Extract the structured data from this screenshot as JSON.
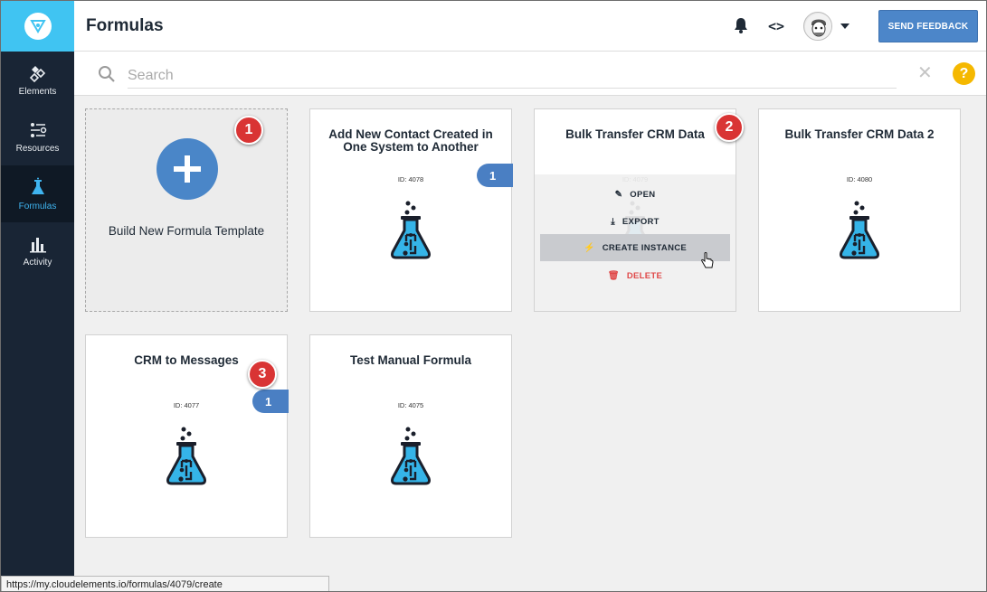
{
  "sidebar": {
    "items": [
      {
        "label": "Elements",
        "icon": "elements-icon"
      },
      {
        "label": "Resources",
        "icon": "resources-icon"
      },
      {
        "label": "Formulas",
        "icon": "flask-icon",
        "active": true
      },
      {
        "label": "Activity",
        "icon": "bar-chart-icon"
      }
    ]
  },
  "header": {
    "title": "Formulas",
    "feedback_button": "SEND FEEDBACK"
  },
  "search": {
    "placeholder": "Search",
    "value": "",
    "clear": "✕",
    "help": "?"
  },
  "cards": {
    "build": {
      "label": "Build New Formula Template"
    },
    "c1": {
      "title": "Add New Contact Created in One System to Another",
      "id": "ID: 4078",
      "count": "1"
    },
    "c2": {
      "title": "Bulk Transfer CRM Data",
      "id": "ID: 4079"
    },
    "c3": {
      "title": "Bulk Transfer CRM Data 2",
      "id": "ID: 4080"
    },
    "c4": {
      "title": "CRM to Messages",
      "id": "ID: 4077",
      "count": "1"
    },
    "c5": {
      "title": "Test Manual Formula",
      "id": "ID: 4075"
    }
  },
  "card_menu": {
    "open": "OPEN",
    "export": "EXPORT",
    "create_instance": "CREATE INSTANCE",
    "delete": "DELETE"
  },
  "callouts": {
    "one": "1",
    "two": "2",
    "three": "3"
  },
  "status_url": "https://my.cloudelements.io/formulas/4079/create",
  "colors": {
    "sidebar": "#192535",
    "logo_bg": "#40c4f2",
    "accent_blue": "#4a86c8",
    "danger": "#e04848",
    "callout_red": "#d93434",
    "help_yellow": "#f5b800"
  }
}
